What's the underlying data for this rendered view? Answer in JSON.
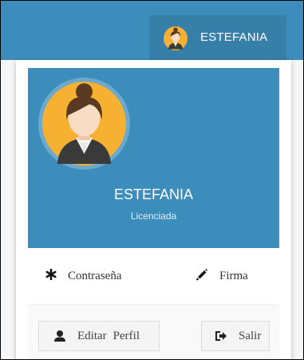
{
  "user": {
    "name": "ESTEFANIA",
    "role": "Licenciada"
  },
  "menu": {
    "password_label": "Contraseña",
    "signature_label": "Firma",
    "edit_label_1": "Editar",
    "edit_label_2": "Perfil",
    "logout_label": "Salir"
  },
  "icons": {
    "password": "asterisk-icon",
    "signature": "pencil-icon",
    "profile": "user-icon",
    "logout": "sign-out-icon"
  },
  "colors": {
    "primary": "#3c8dbc",
    "primary_dark": "#367fa9",
    "avatar_bg": "#f6b133"
  }
}
